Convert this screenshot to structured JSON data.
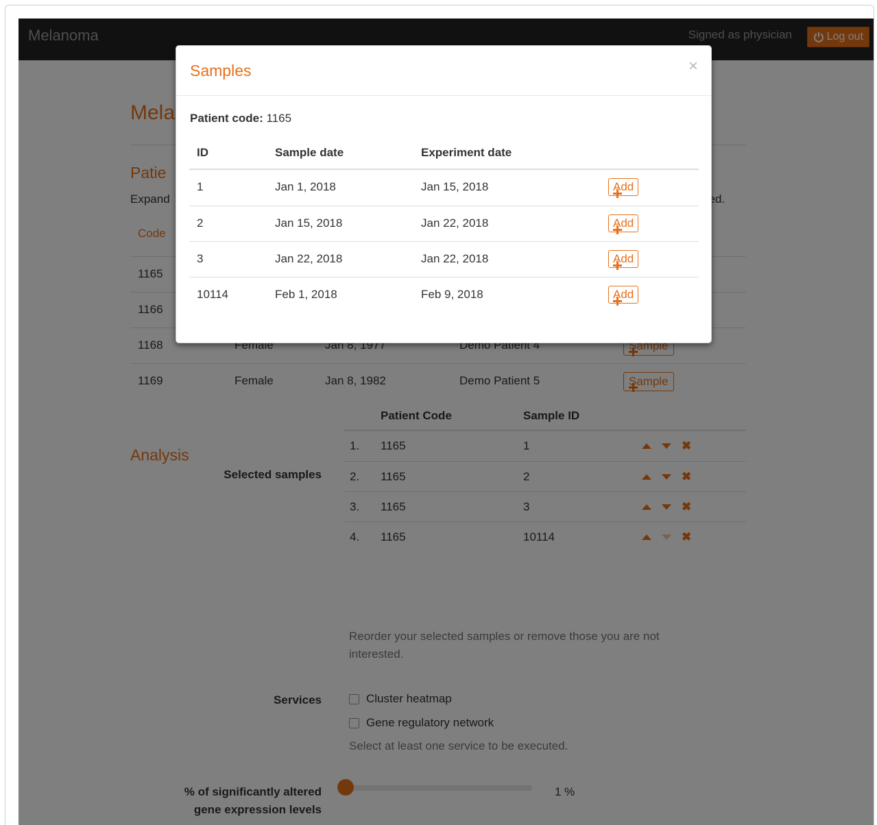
{
  "navbar": {
    "brand": "Melanoma",
    "signed_as": "Signed as physician",
    "logout_label": "Log out"
  },
  "page": {
    "title": "Mela",
    "patients_heading": "Patie",
    "intro_left": "Expand",
    "intro_right": "sed.",
    "code_header": "Code",
    "patients": [
      {
        "code": "1165"
      },
      {
        "code": "1166"
      },
      {
        "code": "1168",
        "gender": "Female",
        "birth": "Jan 8, 1977",
        "name": "Demo Patient 4",
        "button": "Sample"
      },
      {
        "code": "1169",
        "gender": "Female",
        "birth": "Jan 8, 1982",
        "name": "Demo Patient 5",
        "button": "Sample"
      }
    ]
  },
  "analysis": {
    "heading": "Analysis",
    "selected_label": "Selected samples",
    "col_patient_code": "Patient Code",
    "col_sample_id": "Sample ID",
    "rows": [
      {
        "idx": "1.",
        "patient": "1165",
        "sample": "1"
      },
      {
        "idx": "2.",
        "patient": "1165",
        "sample": "2"
      },
      {
        "idx": "3.",
        "patient": "1165",
        "sample": "3"
      },
      {
        "idx": "4.",
        "patient": "1165",
        "sample": "10114"
      }
    ],
    "reorder_help": "Reorder your selected samples or remove those you are not interested.",
    "services_label": "Services",
    "service_1": "Cluster heatmap",
    "service_2": "Gene regulatory network",
    "services_help": "Select at least one service to be executed.",
    "threshold_label_1": "% of significantly altered",
    "threshold_label_2": "gene expression levels",
    "threshold_value": "1 %",
    "threshold_percent": 1
  },
  "modal": {
    "title": "Samples",
    "close": "×",
    "patient_code_label": "Patient code:",
    "patient_code": "1165",
    "col_id": "ID",
    "col_sample_date": "Sample date",
    "col_experiment_date": "Experiment date",
    "add_label": "Add",
    "rows": [
      {
        "id": "1",
        "sample_date": "Jan 1, 2018",
        "experiment_date": "Jan 15, 2018"
      },
      {
        "id": "2",
        "sample_date": "Jan 15, 2018",
        "experiment_date": "Jan 22, 2018"
      },
      {
        "id": "3",
        "sample_date": "Jan 22, 2018",
        "experiment_date": "Jan 22, 2018"
      },
      {
        "id": "10114",
        "sample_date": "Feb 1, 2018",
        "experiment_date": "Feb 9, 2018"
      }
    ]
  },
  "colors": {
    "accent": "#e8701a",
    "navbar": "#222222"
  }
}
